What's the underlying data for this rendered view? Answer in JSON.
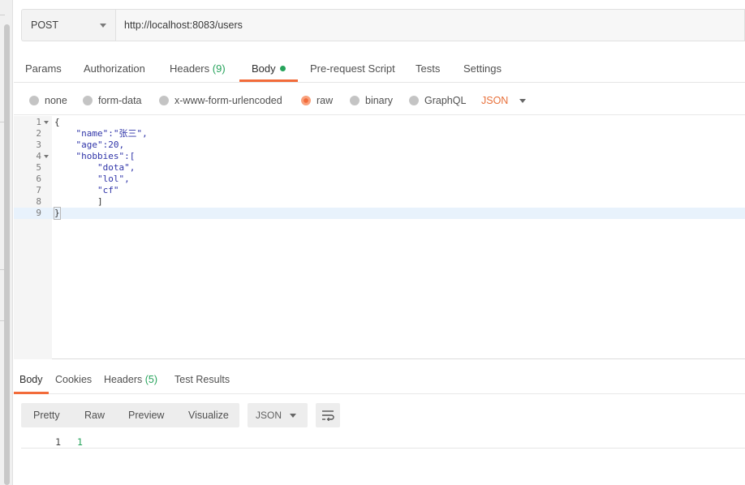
{
  "request": {
    "method": "POST",
    "url": "http://localhost:8083/users"
  },
  "request_tabs": [
    {
      "label": "Params"
    },
    {
      "label": "Authorization"
    },
    {
      "label": "Headers",
      "count": "(9)"
    },
    {
      "label": "Body"
    },
    {
      "label": "Pre-request Script"
    },
    {
      "label": "Tests"
    },
    {
      "label": "Settings"
    }
  ],
  "active_request_tab": "Body",
  "body_types": [
    {
      "label": "none"
    },
    {
      "label": "form-data"
    },
    {
      "label": "x-www-form-urlencoded"
    },
    {
      "label": "raw"
    },
    {
      "label": "binary"
    },
    {
      "label": "GraphQL"
    }
  ],
  "selected_body_type": "raw",
  "raw_format": "JSON",
  "editor": {
    "lines": [
      {
        "n": "1",
        "text": "{"
      },
      {
        "n": "2",
        "text": "    \"name\":\"张三\","
      },
      {
        "n": "3",
        "text": "    \"age\":20,"
      },
      {
        "n": "4",
        "text": "    \"hobbies\":["
      },
      {
        "n": "5",
        "text": "        \"dota\","
      },
      {
        "n": "6",
        "text": "        \"lol\","
      },
      {
        "n": "7",
        "text": "        \"cf\""
      },
      {
        "n": "8",
        "text": "        ]"
      },
      {
        "n": "9",
        "text": "}"
      }
    ],
    "highlighted_line": "9"
  },
  "response_tabs": [
    {
      "label": "Body"
    },
    {
      "label": "Cookies"
    },
    {
      "label": "Headers",
      "count": "(5)"
    },
    {
      "label": "Test Results"
    }
  ],
  "response_views": [
    {
      "label": "Pretty"
    },
    {
      "label": "Raw"
    },
    {
      "label": "Preview"
    },
    {
      "label": "Visualize"
    }
  ],
  "response_format": "JSON",
  "response_body": {
    "line_number": "1",
    "value": "1"
  },
  "colors": {
    "accent": "#f26b3a",
    "count_green": "#26a35b",
    "json_orange": "#e8703a"
  }
}
